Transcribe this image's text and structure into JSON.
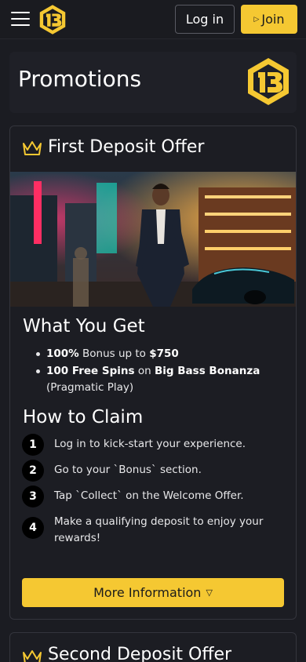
{
  "header": {
    "login_label": "Log in",
    "join_label": "Join"
  },
  "banner": {
    "title": "Promotions"
  },
  "offer": {
    "title": "First Deposit Offer",
    "what_heading": "What You Get",
    "benefits": [
      {
        "strong1": "100%",
        "text1": " Bonus up to ",
        "strong2": "$750",
        "text2": ""
      },
      {
        "strong1": "100 Free Spins",
        "text1": " on ",
        "strong2": "Big Bass Bonanza",
        "text2": " (Pragmatic Play)"
      }
    ],
    "how_heading": "How to Claim",
    "steps": [
      {
        "num": "1",
        "text": "Log in to kick-start your experience."
      },
      {
        "num": "2",
        "text": "Go to your `Bonus` section."
      },
      {
        "num": "3",
        "text": "Tap `Collect` on the Welcome Offer."
      },
      {
        "num": "4",
        "text": "Make a qualifying deposit to enjoy your rewards!"
      }
    ],
    "more_label": "More Information"
  },
  "offer2": {
    "title": "Second Deposit Offer"
  },
  "colors": {
    "accent": "#f5c832",
    "background": "#1b1c22"
  }
}
